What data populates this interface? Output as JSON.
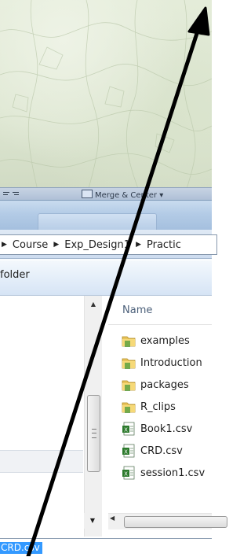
{
  "ribbon": {
    "merge_label": "Merge & Center ▾"
  },
  "address": {
    "crumbs": [
      "Course",
      "Exp_Design1",
      "Practic"
    ]
  },
  "toolbar": {
    "new_folder_fragment": "folder"
  },
  "file_list": {
    "column_name": "Name",
    "items": [
      {
        "name": "examples",
        "icon": "folder-icon"
      },
      {
        "name": "Introduction",
        "icon": "folder-icon"
      },
      {
        "name": "packages",
        "icon": "folder-icon"
      },
      {
        "name": "R_clips",
        "icon": "folder-icon"
      },
      {
        "name": "Book1.csv",
        "icon": "excel-csv-icon"
      },
      {
        "name": "CRD.csv",
        "icon": "excel-csv-icon"
      },
      {
        "name": "session1.csv",
        "icon": "excel-csv-icon"
      }
    ]
  },
  "filename_field": {
    "value": "CRD.csv"
  },
  "colors": {
    "selection": "#3399ff",
    "annotation_arrow": "#000000"
  }
}
